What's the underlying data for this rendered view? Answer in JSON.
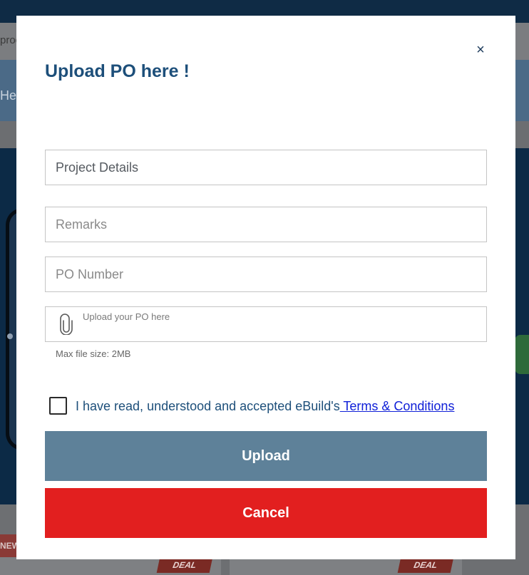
{
  "background": {
    "search_fragment": "proc",
    "help_fragment": "Help",
    "new_badge": "NEW",
    "deal_badges": [
      "DEAL",
      "DEAL"
    ]
  },
  "modal": {
    "title": "Upload PO here !",
    "close_glyph": "×",
    "close_icon": "close-icon",
    "fields": {
      "project_details_placeholder": "Project Details",
      "remarks_placeholder": "Remarks",
      "po_number_placeholder": "PO Number"
    },
    "upload": {
      "icon": "paperclip-icon",
      "label": "Upload your PO here",
      "max_size": "Max file size: 2MB"
    },
    "terms": {
      "text": "I have read, understood and accepted eBuild's",
      "link": " Terms & Conditions",
      "checked": false
    },
    "buttons": {
      "upload": "Upload",
      "cancel": "Cancel"
    },
    "colors": {
      "title": "#1d4f7a",
      "upload_button": "#5e8199",
      "cancel_button": "#e21f1f",
      "link": "#1020d8"
    }
  }
}
